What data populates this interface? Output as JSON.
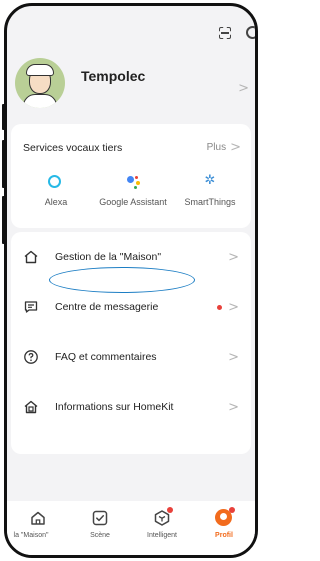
{
  "profile": {
    "name": "Tempolec"
  },
  "voice_services": {
    "title": "Services vocaux tiers",
    "more_label": "Plus",
    "assistants": [
      {
        "label": "Alexa",
        "icon": "alexa-icon"
      },
      {
        "label": "Google Assistant",
        "icon": "google-assistant-icon"
      },
      {
        "label": "SmartThings",
        "icon": "smartthings-icon"
      }
    ]
  },
  "menu": {
    "items": [
      {
        "label": "Gestion de la \"Maison\"",
        "icon": "home-icon"
      },
      {
        "label": "Centre de messagerie",
        "icon": "message-icon",
        "has_notification": true
      },
      {
        "label": "FAQ et commentaires",
        "icon": "question-icon"
      },
      {
        "label": "Informations sur HomeKit",
        "icon": "homekit-icon"
      }
    ]
  },
  "tabbar": {
    "tabs": [
      {
        "label": "la \"Maison\"",
        "icon": "home-icon"
      },
      {
        "label": "Scène",
        "icon": "scene-icon"
      },
      {
        "label": "Intelligent",
        "icon": "intelligent-icon"
      },
      {
        "label": "Profil",
        "icon": "profile-icon",
        "active": true
      }
    ]
  },
  "colors": {
    "accent": "#f26b1d",
    "notification": "#e8413b",
    "highlight": "#1d7ec4",
    "background": "#f3f3f5"
  }
}
